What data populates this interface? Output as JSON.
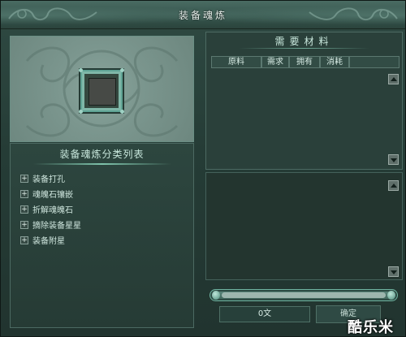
{
  "window": {
    "title": "装备魂炼"
  },
  "category_list": {
    "header": "装备魂炼分类列表",
    "items": [
      {
        "label": "装备打孔"
      },
      {
        "label": "魂魄石镶嵌"
      },
      {
        "label": "折解魂魄石"
      },
      {
        "label": "摘除装备星星"
      },
      {
        "label": "装备附星"
      }
    ],
    "expand_glyph": "+"
  },
  "materials": {
    "title": "需要材料",
    "columns": [
      "原料",
      "需求",
      "拥有",
      "消耗"
    ],
    "rows": []
  },
  "progress": {
    "value": 0
  },
  "cost": {
    "value": "0文"
  },
  "confirm_button": {
    "label": "确定"
  },
  "watermark": {
    "text": "酷乐米"
  },
  "colors": {
    "panel": "#2a403a",
    "frame_accent": "#6fb3a0",
    "text": "#cfe6de"
  }
}
